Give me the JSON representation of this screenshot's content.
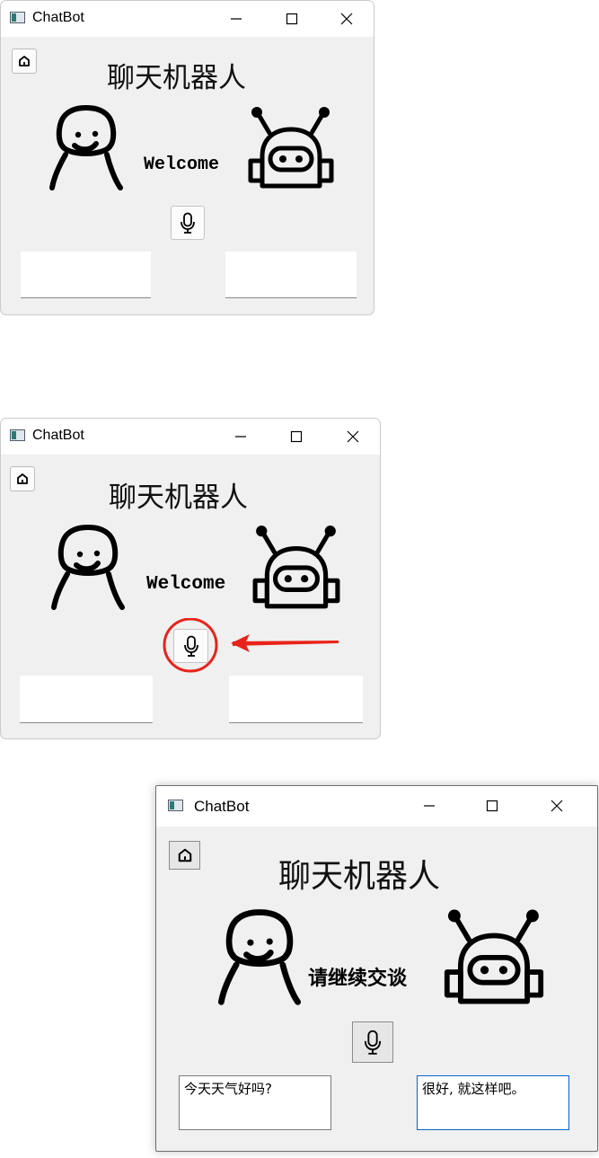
{
  "window": {
    "title": "ChatBot",
    "controls": [
      "minimize",
      "maximize",
      "close"
    ]
  },
  "app": {
    "heading": "聊天机器人",
    "home_icon": "home-icon",
    "mic_icon": "microphone-icon",
    "user_avatar": "person-icon",
    "bot_avatar": "robot-icon"
  },
  "panels": [
    {
      "status": "Welcome",
      "user_text": "",
      "bot_text": ""
    },
    {
      "status": "Welcome",
      "user_text": "",
      "bot_text": "",
      "annotation": {
        "type": "circle-and-arrow",
        "color": "#e8231a",
        "target": "mic-button"
      }
    },
    {
      "status": "请继续交谈",
      "user_text": "今天天气好吗?",
      "bot_text": "很好, 就这样吧。"
    }
  ]
}
